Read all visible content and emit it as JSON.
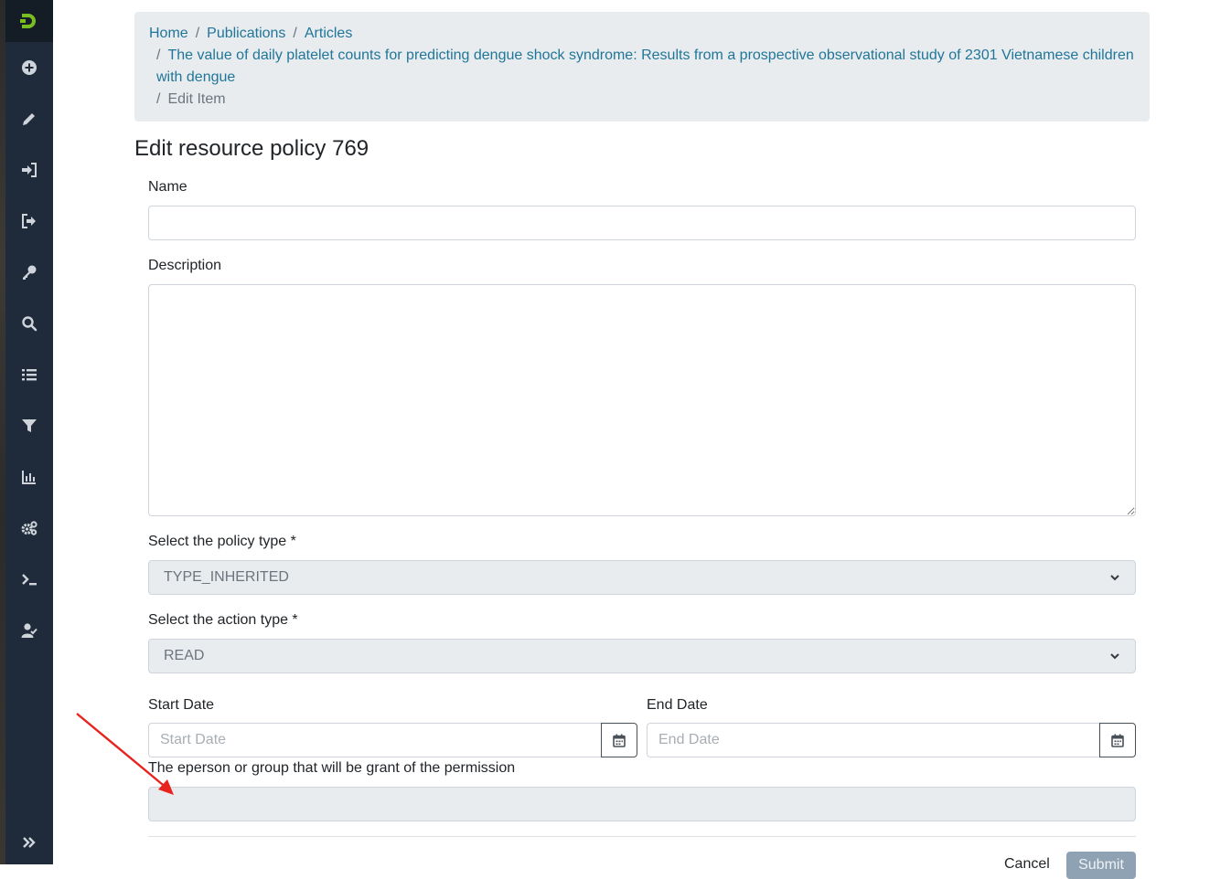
{
  "sidebar": {
    "logo_icon": "dspace-logo-icon",
    "items": [
      {
        "name": "sidebar-item-new",
        "icon": "plus-circle-icon"
      },
      {
        "name": "sidebar-item-edit",
        "icon": "pencil-icon"
      },
      {
        "name": "sidebar-item-import",
        "icon": "sign-in-icon"
      },
      {
        "name": "sidebar-item-export",
        "icon": "sign-out-icon"
      },
      {
        "name": "sidebar-item-access-control",
        "icon": "key-icon"
      },
      {
        "name": "sidebar-item-admin-search",
        "icon": "search-icon"
      },
      {
        "name": "sidebar-item-registries",
        "icon": "list-icon"
      },
      {
        "name": "sidebar-item-curation-task",
        "icon": "filter-icon"
      },
      {
        "name": "sidebar-item-statistics",
        "icon": "chart-icon"
      },
      {
        "name": "sidebar-item-workflow",
        "icon": "gears-icon"
      },
      {
        "name": "sidebar-item-processes",
        "icon": "terminal-icon"
      },
      {
        "name": "sidebar-item-health",
        "icon": "user-check-icon"
      }
    ],
    "collapse_icon": "double-chevron-right-icon",
    "bg_color": "#1f2b3a"
  },
  "breadcrumb": {
    "home": "Home",
    "publications": "Publications",
    "articles": "Articles",
    "item": "The value of daily platelet counts for predicting dengue shock syndrome: Results from a prospective observational study of 2301 Vietnamese children with dengue",
    "current": "Edit Item",
    "separator": "/"
  },
  "page": {
    "title": "Edit resource policy 769"
  },
  "form": {
    "name_label": "Name",
    "name_value": "",
    "description_label": "Description",
    "description_value": "",
    "policy_type_label": "Select the policy type *",
    "policy_type_value": "TYPE_INHERITED",
    "action_type_label": "Select the action type *",
    "action_type_value": "READ",
    "start_date_label": "Start Date",
    "start_date_placeholder": "Start Date",
    "end_date_label": "End Date",
    "end_date_placeholder": "End Date",
    "grant_label": "The eperson or group that will be grant of the permission",
    "grant_value": "",
    "cancel_label": "Cancel",
    "submit_label": "Submit"
  },
  "colors": {
    "link": "#207698",
    "annotation_arrow": "#e8231d",
    "disabled_field": "#e9ecef"
  }
}
